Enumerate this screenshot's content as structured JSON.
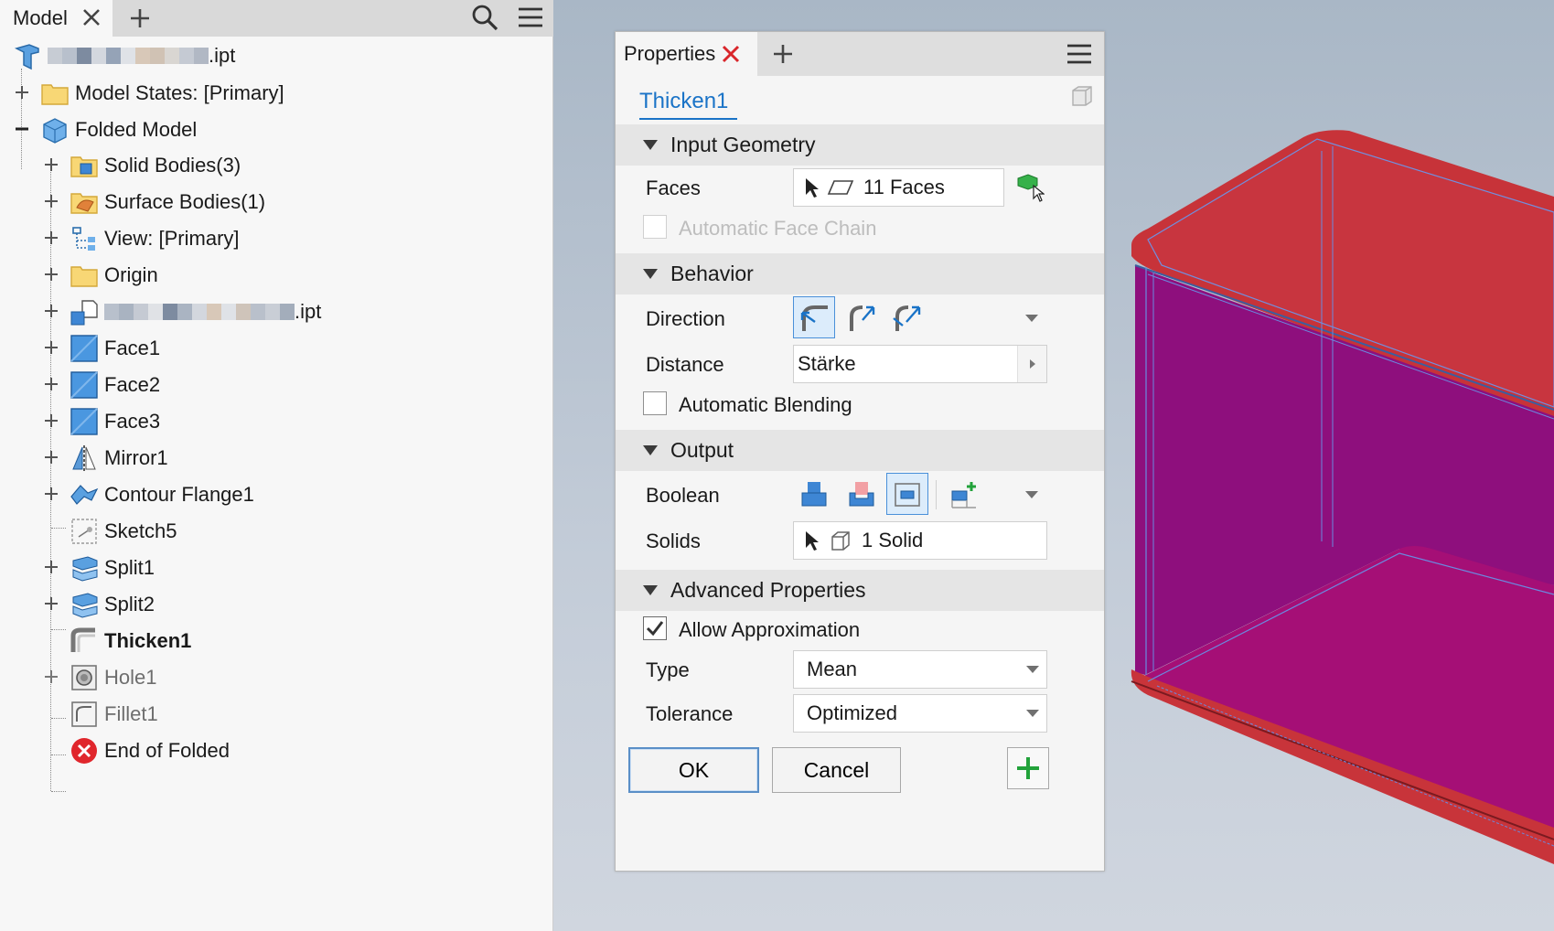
{
  "model_panel": {
    "tab_label": "Model",
    "tree": [
      {
        "name": "tree-root-part",
        "label": ".ipt",
        "blurred": true
      },
      {
        "name": "tree-model-states",
        "label": "Model States: [Primary]"
      },
      {
        "name": "tree-folded-model",
        "label": "Folded Model"
      },
      {
        "name": "tree-solid-bodies",
        "label": "Solid Bodies(3)"
      },
      {
        "name": "tree-surface-bodies",
        "label": "Surface Bodies(1)"
      },
      {
        "name": "tree-view-primary",
        "label": "View: [Primary]"
      },
      {
        "name": "tree-origin",
        "label": "Origin"
      },
      {
        "name": "tree-derived-part",
        "label": ".ipt",
        "blurred": true
      },
      {
        "name": "tree-face1",
        "label": "Face1"
      },
      {
        "name": "tree-face2",
        "label": "Face2"
      },
      {
        "name": "tree-face3",
        "label": "Face3"
      },
      {
        "name": "tree-mirror1",
        "label": "Mirror1"
      },
      {
        "name": "tree-contour-flange1",
        "label": "Contour Flange1"
      },
      {
        "name": "tree-sketch5",
        "label": "Sketch5"
      },
      {
        "name": "tree-split1",
        "label": "Split1"
      },
      {
        "name": "tree-split2",
        "label": "Split2"
      },
      {
        "name": "tree-thicken1",
        "label": "Thicken1"
      },
      {
        "name": "tree-hole1",
        "label": "Hole1"
      },
      {
        "name": "tree-fillet1",
        "label": "Fillet1"
      },
      {
        "name": "tree-end-of-folded",
        "label": "End of Folded"
      }
    ]
  },
  "properties": {
    "tab_label": "Properties",
    "feature_name": "Thicken1",
    "input_geometry": {
      "title": "Input Geometry",
      "faces_label": "Faces",
      "faces_value": "11 Faces",
      "auto_face_chain": "Automatic Face Chain"
    },
    "behavior": {
      "title": "Behavior",
      "direction_label": "Direction",
      "distance_label": "Distance",
      "distance_value": "Stärke",
      "auto_blending": "Automatic Blending"
    },
    "output": {
      "title": "Output",
      "boolean_label": "Boolean",
      "solids_label": "Solids",
      "solids_value": "1 Solid"
    },
    "advanced": {
      "title": "Advanced Properties",
      "allow_approx": "Allow Approximation",
      "type_label": "Type",
      "type_value": "Mean",
      "tolerance_label": "Tolerance",
      "tolerance_value": "Optimized"
    },
    "buttons": {
      "ok": "OK",
      "cancel": "Cancel"
    }
  },
  "colors": {
    "accent": "#1a73c7",
    "close_red": "#d9262b",
    "plus_green": "#22a23a",
    "part_red": "#c8343a",
    "part_magenta": "#8f0e7e"
  }
}
